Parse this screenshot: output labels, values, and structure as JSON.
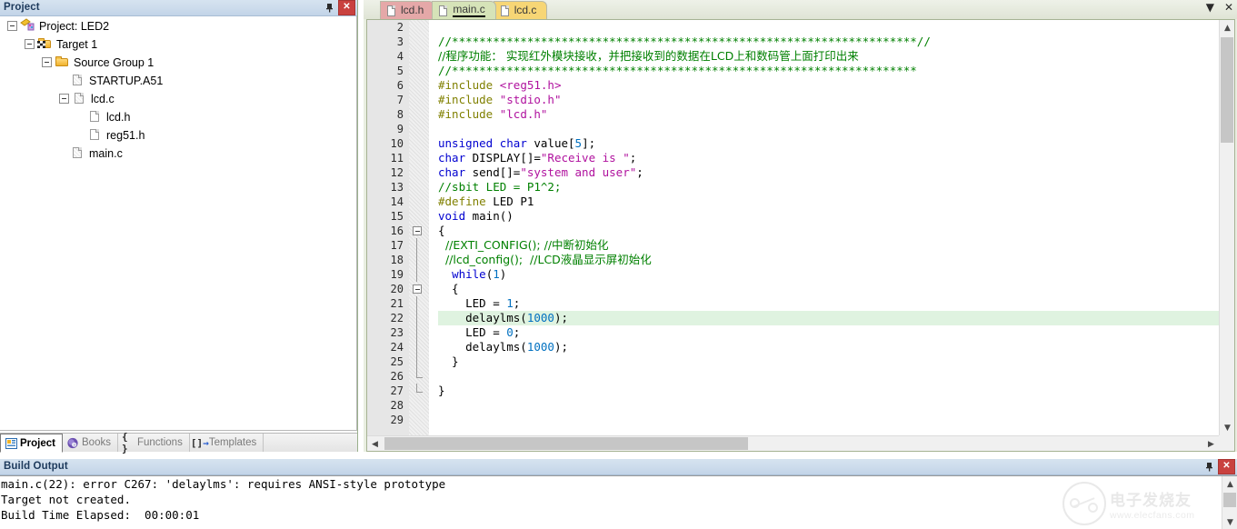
{
  "project_panel": {
    "title": "Project",
    "pin_icon": "pin-icon",
    "close_icon": "close-icon",
    "tree": [
      {
        "label": "Project: LED2",
        "depth": 0,
        "icon": "project-icon",
        "expander": "minus"
      },
      {
        "label": "Target 1",
        "depth": 1,
        "icon": "target-folder-icon",
        "expander": "minus"
      },
      {
        "label": "Source Group 1",
        "depth": 2,
        "icon": "folder-icon",
        "expander": "minus"
      },
      {
        "label": "STARTUP.A51",
        "depth": 3,
        "icon": "source-file-icon",
        "expander": "none"
      },
      {
        "label": "lcd.c",
        "depth": 3,
        "icon": "source-file-icon",
        "expander": "minus"
      },
      {
        "label": "lcd.h",
        "depth": 4,
        "icon": "header-file-icon",
        "expander": "none"
      },
      {
        "label": "reg51.h",
        "depth": 4,
        "icon": "header-file-icon",
        "expander": "none"
      },
      {
        "label": "main.c",
        "depth": 3,
        "icon": "source-file-icon",
        "expander": "none"
      }
    ],
    "bottom_tabs": [
      {
        "label": "Project",
        "icon": "project-tab-icon",
        "active": true
      },
      {
        "label": "Books",
        "icon": "books-globe-icon",
        "active": false
      },
      {
        "label": "Functions",
        "icon": "braces-icon",
        "active": false
      },
      {
        "label": "Templates",
        "icon": "brackets-arrow-icon",
        "active": false
      }
    ]
  },
  "editor": {
    "tabs": [
      {
        "label": "lcd.h",
        "active": false,
        "color": "#e5a8a8"
      },
      {
        "label": "main.c",
        "active": true,
        "color": "#d6e3b8"
      },
      {
        "label": "lcd.c",
        "active": false,
        "color": "#f7d675"
      }
    ],
    "window_dropdown_icon": "chevron-down-icon",
    "window_close_icon": "close-icon",
    "highlight_line": 22,
    "lines": [
      {
        "n": 2,
        "tokens": []
      },
      {
        "n": 3,
        "tokens": [
          {
            "t": "//********************************************************************//",
            "c": "cmt"
          }
        ]
      },
      {
        "n": 4,
        "tokens": [
          {
            "t": "//程序功能： 实现红外模块接收，并把接收到的数据在LCD上和数码管上面打印出来",
            "c": "cmt cn"
          }
        ]
      },
      {
        "n": 5,
        "tokens": [
          {
            "t": "//********************************************************************",
            "c": "cmt"
          }
        ]
      },
      {
        "n": 6,
        "tokens": [
          {
            "t": "#include",
            "c": "pre"
          },
          {
            "t": " ",
            "c": "pun"
          },
          {
            "t": "<reg51.h>",
            "c": "str"
          }
        ]
      },
      {
        "n": 7,
        "tokens": [
          {
            "t": "#include",
            "c": "pre"
          },
          {
            "t": " ",
            "c": "pun"
          },
          {
            "t": "\"stdio.h\"",
            "c": "str"
          }
        ]
      },
      {
        "n": 8,
        "tokens": [
          {
            "t": "#include",
            "c": "pre"
          },
          {
            "t": " ",
            "c": "pun"
          },
          {
            "t": "\"lcd.h\"",
            "c": "str"
          }
        ]
      },
      {
        "n": 9,
        "tokens": []
      },
      {
        "n": 10,
        "tokens": [
          {
            "t": "unsigned",
            "c": "kw"
          },
          {
            "t": " ",
            "c": "pun"
          },
          {
            "t": "char",
            "c": "kw"
          },
          {
            "t": " value[",
            "c": "pun"
          },
          {
            "t": "5",
            "c": "num"
          },
          {
            "t": "];",
            "c": "pun"
          }
        ]
      },
      {
        "n": 11,
        "tokens": [
          {
            "t": "char",
            "c": "kw"
          },
          {
            "t": " DISPLAY[]=",
            "c": "pun"
          },
          {
            "t": "\"Receive is \"",
            "c": "str"
          },
          {
            "t": ";",
            "c": "pun"
          }
        ]
      },
      {
        "n": 12,
        "tokens": [
          {
            "t": "char",
            "c": "kw"
          },
          {
            "t": " send[]=",
            "c": "pun"
          },
          {
            "t": "\"system and user\"",
            "c": "str"
          },
          {
            "t": ";",
            "c": "pun"
          }
        ]
      },
      {
        "n": 13,
        "tokens": [
          {
            "t": "//sbit LED = P1^2;",
            "c": "cmt"
          }
        ]
      },
      {
        "n": 14,
        "tokens": [
          {
            "t": "#define",
            "c": "pre"
          },
          {
            "t": " LED P1",
            "c": "pun"
          }
        ]
      },
      {
        "n": 15,
        "tokens": [
          {
            "t": "void",
            "c": "kw"
          },
          {
            "t": " main()",
            "c": "pun"
          }
        ]
      },
      {
        "n": 16,
        "tokens": [
          {
            "t": "{",
            "c": "pun"
          }
        ],
        "fold": "start"
      },
      {
        "n": 17,
        "tokens": [
          {
            "t": "  //EXTI_CONFIG(); //中断初始化",
            "c": "cmt cn"
          }
        ],
        "fold": "bar"
      },
      {
        "n": 18,
        "tokens": [
          {
            "t": "  //lcd_config();  //LCD液晶显示屏初始化",
            "c": "cmt cn"
          }
        ],
        "fold": "bar"
      },
      {
        "n": 19,
        "tokens": [
          {
            "t": "  ",
            "c": "pun"
          },
          {
            "t": "while",
            "c": "kw"
          },
          {
            "t": "(",
            "c": "pun"
          },
          {
            "t": "1",
            "c": "num"
          },
          {
            "t": ")",
            "c": "pun"
          }
        ],
        "fold": "bar"
      },
      {
        "n": 20,
        "tokens": [
          {
            "t": "  {",
            "c": "pun"
          }
        ],
        "fold": "start2"
      },
      {
        "n": 21,
        "tokens": [
          {
            "t": "    LED = ",
            "c": "pun"
          },
          {
            "t": "1",
            "c": "num"
          },
          {
            "t": ";",
            "c": "pun"
          }
        ],
        "fold": "bar"
      },
      {
        "n": 22,
        "tokens": [
          {
            "t": "    delaylms(",
            "c": "pun"
          },
          {
            "t": "1000",
            "c": "num"
          },
          {
            "t": ");",
            "c": "pun"
          }
        ],
        "fold": "bar"
      },
      {
        "n": 23,
        "tokens": [
          {
            "t": "    LED = ",
            "c": "pun"
          },
          {
            "t": "0",
            "c": "num"
          },
          {
            "t": ";",
            "c": "pun"
          }
        ],
        "fold": "bar"
      },
      {
        "n": 24,
        "tokens": [
          {
            "t": "    delaylms(",
            "c": "pun"
          },
          {
            "t": "1000",
            "c": "num"
          },
          {
            "t": ");",
            "c": "pun"
          }
        ],
        "fold": "bar"
      },
      {
        "n": 25,
        "tokens": [
          {
            "t": "  }",
            "c": "pun"
          }
        ],
        "fold": "bar"
      },
      {
        "n": 26,
        "tokens": [],
        "fold": "end2"
      },
      {
        "n": 27,
        "tokens": [
          {
            "t": "}",
            "c": "pun"
          }
        ],
        "fold": "end"
      },
      {
        "n": 28,
        "tokens": []
      },
      {
        "n": 29,
        "tokens": []
      }
    ]
  },
  "build_output": {
    "title": "Build Output",
    "pin_icon": "pin-icon",
    "close_icon": "close-icon",
    "lines": [
      "main.c(22): error C267: 'delaylms': requires ANSI-style prototype",
      "Target not created.",
      "Build Time Elapsed:  00:00:01"
    ]
  },
  "watermark": {
    "cn": "电子发烧友",
    "en": "www.elecfans.com"
  },
  "colors": {
    "keyword": "#0000d0",
    "string": "#b0119e",
    "comment": "#008000",
    "preprocessor": "#808000",
    "number": "#0070c0",
    "highlight_line_bg": "#dff3e0",
    "panel_header": "#c2d4e8",
    "close_button": "#c9413f"
  }
}
